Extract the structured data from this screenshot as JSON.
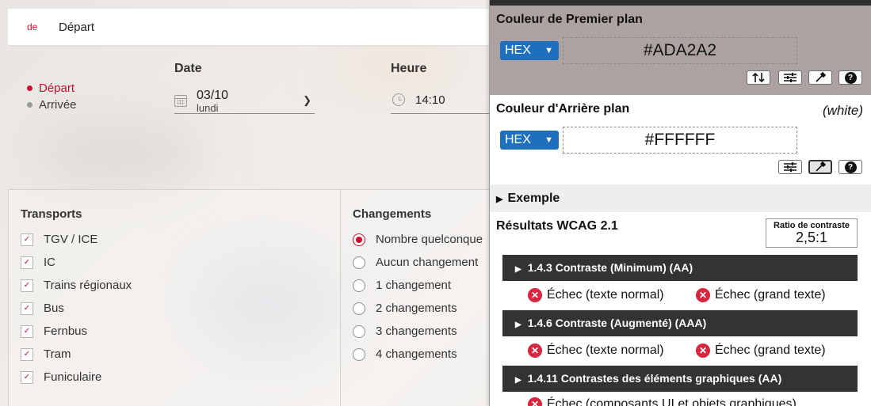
{
  "search": {
    "from_prefix": "de",
    "from_value": "Départ",
    "mode_options": [
      {
        "label": "Départ",
        "selected": true
      },
      {
        "label": "Arrivée",
        "selected": false
      }
    ],
    "date_label": "Date",
    "date_value": "03/10",
    "date_weekday": "lundi",
    "time_label": "Heure",
    "time_value": "14:10"
  },
  "transports": {
    "title": "Transports",
    "items": [
      {
        "label": "TGV / ICE",
        "checked": true
      },
      {
        "label": "IC",
        "checked": true
      },
      {
        "label": "Trains régionaux",
        "checked": true
      },
      {
        "label": "Bus",
        "checked": true
      },
      {
        "label": "Fernbus",
        "checked": true
      },
      {
        "label": "Tram",
        "checked": true
      },
      {
        "label": "Funiculaire",
        "checked": true
      }
    ]
  },
  "changes": {
    "title": "Changements",
    "items": [
      {
        "label": "Nombre quelconque",
        "selected": true
      },
      {
        "label": "Aucun changement",
        "selected": false
      },
      {
        "label": "1 changement",
        "selected": false
      },
      {
        "label": "2 changements",
        "selected": false
      },
      {
        "label": "3 changements",
        "selected": false
      },
      {
        "label": "4 changements",
        "selected": false
      }
    ]
  },
  "panel": {
    "foreground": {
      "title": "Couleur de Premier plan",
      "format": "HEX",
      "value": "#ADA2A2",
      "color": "#ada2a2"
    },
    "background": {
      "title": "Couleur d'Arrière plan",
      "note": "(white)",
      "format": "HEX",
      "value": "#FFFFFF",
      "color": "#ffffff"
    },
    "example_label": "Exemple",
    "results_title": "Résultats WCAG 2.1",
    "ratio_label": "Ratio de contraste",
    "ratio_value": "2,5:1",
    "help_glyph": "?",
    "criteria": [
      {
        "title": "1.4.3 Contraste (Minimum) (AA)",
        "results": [
          "Échec (texte normal)",
          "Échec (grand texte)"
        ]
      },
      {
        "title": "1.4.6 Contraste (Augmenté) (AAA)",
        "results": [
          "Échec (texte normal)",
          "Échec (grand texte)"
        ]
      },
      {
        "title": "1.4.11 Contrastes des éléments graphiques (AA)",
        "results": [
          "Échec (composants UI et objets graphiques)"
        ]
      }
    ],
    "colors": {
      "fail": "#d7263d",
      "accent": "#1f6fbf",
      "criterion_bar": "#333333"
    }
  },
  "accent_color": "#c8102e"
}
